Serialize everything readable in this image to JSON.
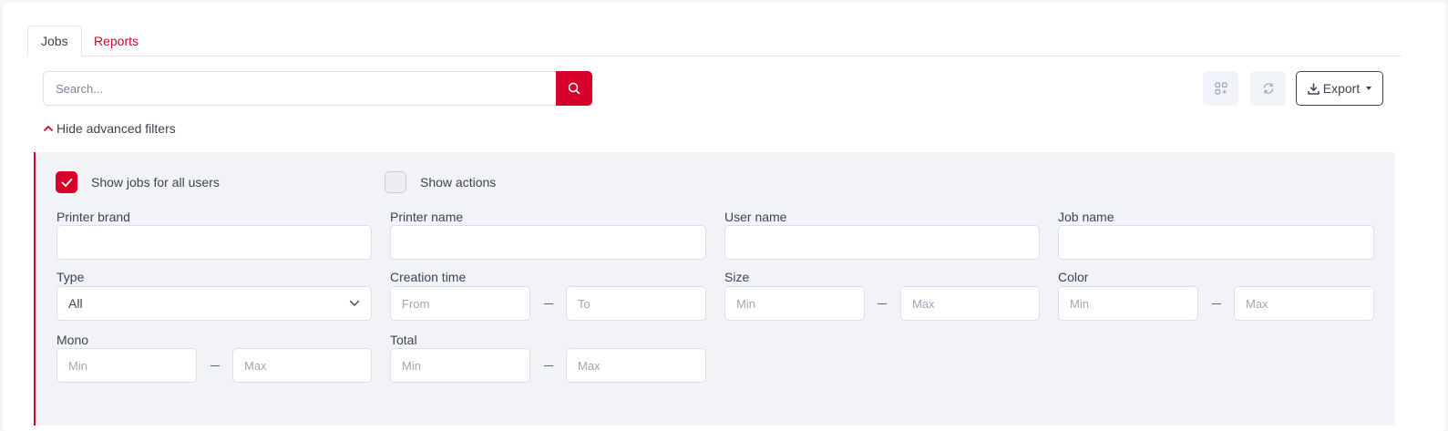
{
  "tabs": [
    {
      "label": "Jobs",
      "active": true
    },
    {
      "label": "Reports",
      "active": false
    }
  ],
  "search": {
    "placeholder": "Search...",
    "value": "",
    "icon": "search-icon"
  },
  "toolbar": {
    "columns_icon": "grid-add-icon",
    "refresh_icon": "refresh-icon",
    "export_label": "Export",
    "export_icon": "download-icon"
  },
  "filters_toggle": {
    "label": "Hide advanced filters",
    "icon": "chevron-up-icon"
  },
  "filters": {
    "show_all_users": {
      "label": "Show jobs for all users",
      "checked": true
    },
    "show_actions": {
      "label": "Show actions",
      "checked": false
    },
    "printer_brand": {
      "label": "Printer brand",
      "value": ""
    },
    "printer_name": {
      "label": "Printer name",
      "value": ""
    },
    "user_name": {
      "label": "User name",
      "value": ""
    },
    "job_name": {
      "label": "Job name",
      "value": ""
    },
    "type": {
      "label": "Type",
      "selected": "All"
    },
    "creation_time": {
      "label": "Creation time",
      "from_placeholder": "From",
      "to_placeholder": "To"
    },
    "size": {
      "label": "Size",
      "min_placeholder": "Min",
      "max_placeholder": "Max"
    },
    "color": {
      "label": "Color",
      "min_placeholder": "Min",
      "max_placeholder": "Max"
    },
    "mono": {
      "label": "Mono",
      "min_placeholder": "Min",
      "max_placeholder": "Max"
    },
    "total": {
      "label": "Total",
      "min_placeholder": "Min",
      "max_placeholder": "Max"
    }
  },
  "colors": {
    "accent": "#d6002a",
    "panel_bg": "#f2f3f7",
    "text": "#3f4254"
  }
}
